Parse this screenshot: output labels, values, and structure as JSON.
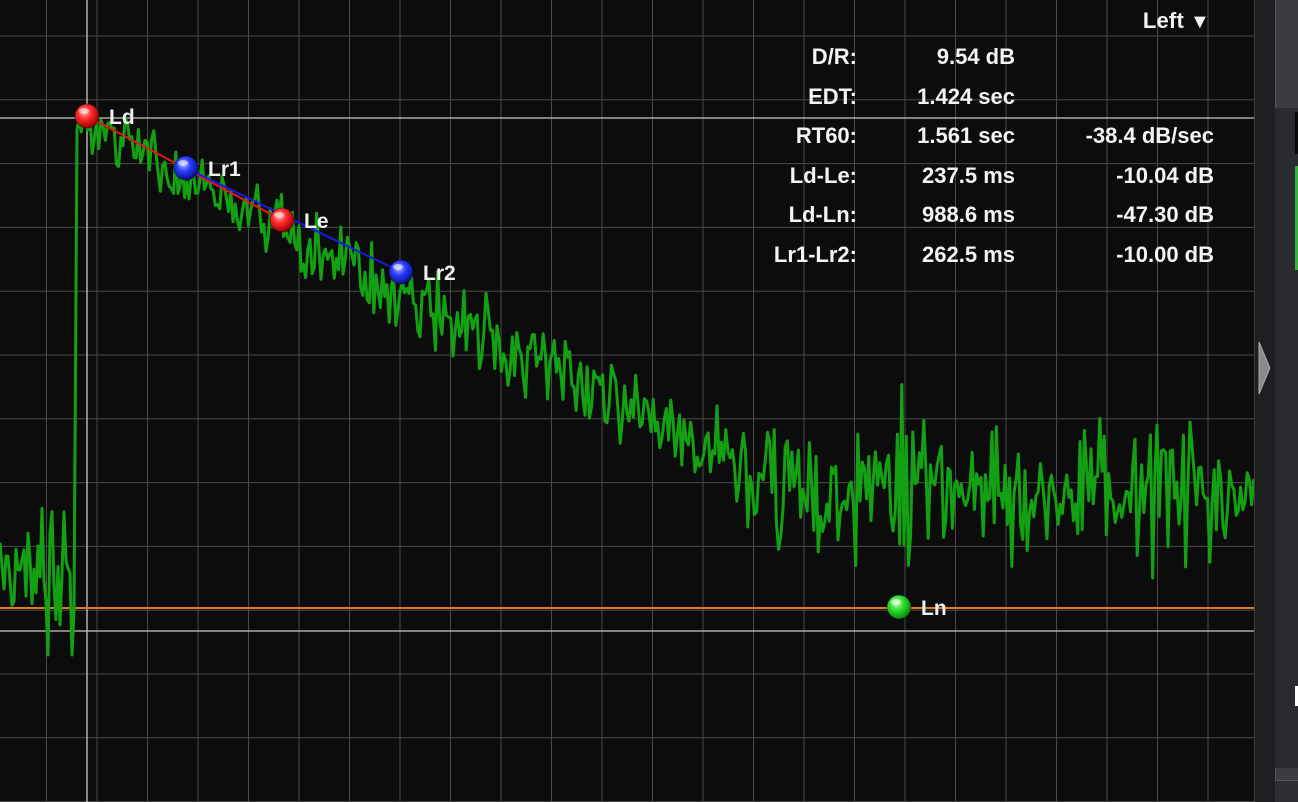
{
  "channel_selector": {
    "label": "Left",
    "arrow": "▼"
  },
  "stats": [
    {
      "label": "D/R:",
      "value": "9.54 dB",
      "extra": ""
    },
    {
      "label": "EDT:",
      "value": "1.424 sec",
      "extra": ""
    },
    {
      "label": "RT60:",
      "value": "1.561 sec",
      "extra": "-38.4 dB/sec"
    },
    {
      "label": "Ld-Le:",
      "value": "237.5 ms",
      "extra": "-10.04 dB"
    },
    {
      "label": "Ld-Ln:",
      "value": "988.6 ms",
      "extra": "-47.30 dB"
    },
    {
      "label": "Lr1-Lr2:",
      "value": "262.5 ms",
      "extra": "-10.00 dB"
    }
  ],
  "markers": [
    {
      "id": "Ld",
      "label": "Ld",
      "color": "red"
    },
    {
      "id": "Lr1",
      "label": "Lr1",
      "color": "blue"
    },
    {
      "id": "Le",
      "label": "Le",
      "color": "red"
    },
    {
      "id": "Lr2",
      "label": "Lr2",
      "color": "blue"
    },
    {
      "id": "Ln",
      "label": "Ln",
      "color": "green"
    }
  ],
  "colors": {
    "curve": "#13a113",
    "noise_floor_line": "#e07b18",
    "ld_le_line": "#e01818",
    "lr_line": "#1a1adf",
    "grid": "#4a4a4a",
    "crosshair": "#c8c8c8"
  }
}
